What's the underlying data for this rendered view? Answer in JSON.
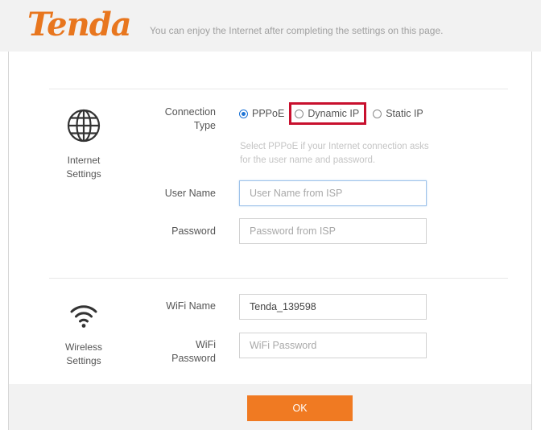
{
  "header": {
    "logo_text": "Tenda",
    "tagline": "You can enjoy the Internet after completing the settings on this page."
  },
  "internet": {
    "section_label_line1": "Internet",
    "section_label_line2": "Settings",
    "icon": "globe-icon",
    "connection_type": {
      "label_line1": "Connection",
      "label_line2": "Type",
      "options": [
        {
          "label": "PPPoE",
          "selected": true
        },
        {
          "label": "Dynamic IP",
          "selected": false,
          "highlighted": true
        },
        {
          "label": "Static IP",
          "selected": false
        }
      ]
    },
    "hint_line1": "Select PPPoE if your Internet connection asks",
    "hint_line2": "for the user name and password.",
    "username": {
      "label": "User Name",
      "value": "",
      "placeholder": "User Name from ISP"
    },
    "password": {
      "label": "Password",
      "value": "",
      "placeholder": "Password from ISP"
    }
  },
  "wireless": {
    "section_label_line1": "Wireless",
    "section_label_line2": "Settings",
    "icon": "wifi-icon",
    "wifi_name": {
      "label": "WiFi Name",
      "value": "Tenda_139598",
      "placeholder": ""
    },
    "wifi_password": {
      "label_line1": "WiFi",
      "label_line2": "Password",
      "value": "",
      "placeholder": "WiFi Password"
    }
  },
  "footer": {
    "ok_label": "OK"
  },
  "colors": {
    "brand": "#e8761e",
    "button": "#f07a22",
    "highlight": "#c8102e",
    "radio_selected": "#1e74d6"
  }
}
